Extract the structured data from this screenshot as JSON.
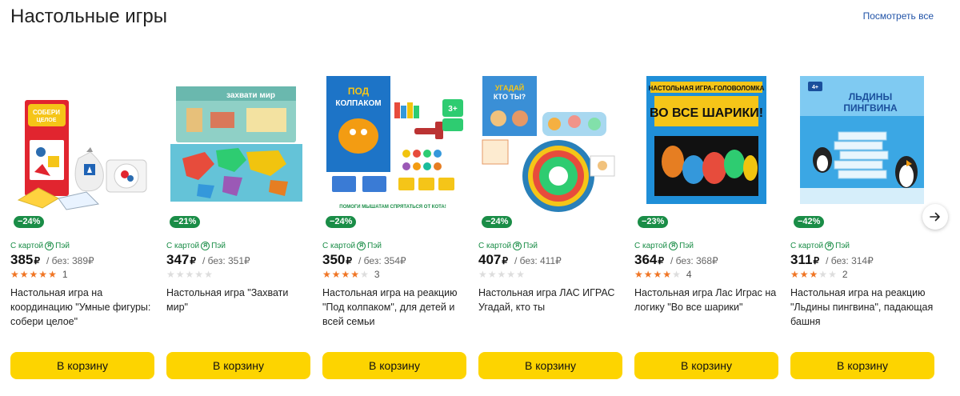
{
  "header": {
    "title": "Настольные игры",
    "see_all": "Посмотреть все"
  },
  "colors": {
    "accent_button": "#fdd400",
    "discount_badge": "#1a8d47",
    "star_on": "#f07524",
    "star_off": "#dddddd",
    "link": "#2254a8"
  },
  "products": [
    {
      "discount": "−24%",
      "pay_label_a": "С картой",
      "pay_label_b": "Пэй",
      "price": "385",
      "currency": "₽",
      "old_price": "/ без: 389₽",
      "rating": 5,
      "reviews": "1",
      "name": "Настольная игра на координацию \"Умные фигуры: собери целое\"",
      "button": "В корзину",
      "image_text": "СОБЕРИ ЦЕЛОЕ"
    },
    {
      "discount": "−21%",
      "pay_label_a": "С картой",
      "pay_label_b": "Пэй",
      "price": "347",
      "currency": "₽",
      "old_price": "/ без: 351₽",
      "rating": 0,
      "reviews": "",
      "name": "Настольная игра \"Захвати мир\"",
      "button": "В корзину",
      "image_text": "ЗАХВАТИ МИР"
    },
    {
      "discount": "−24%",
      "pay_label_a": "С картой",
      "pay_label_b": "Пэй",
      "price": "350",
      "currency": "₽",
      "old_price": "/ без: 354₽",
      "rating": 3.5,
      "reviews": "3",
      "name": "Настольная игра на реакцию \"Под колпаком\", для детей и всей семьи",
      "button": "В корзину",
      "image_text": "ПОМОГИ МЫШАТАМ СПРЯТАТЬСЯ ОТ КОТА!"
    },
    {
      "discount": "−24%",
      "pay_label_a": "С картой",
      "pay_label_b": "Пэй",
      "price": "407",
      "currency": "₽",
      "old_price": "/ без: 411₽",
      "rating": 0,
      "reviews": "",
      "name": "Настольная игра ЛАС ИГРАС Угадай, кто ты",
      "button": "В корзину",
      "image_text": "УГАДАЙ КТО ТЫ?"
    },
    {
      "discount": "−23%",
      "pay_label_a": "С картой",
      "pay_label_b": "Пэй",
      "price": "364",
      "currency": "₽",
      "old_price": "/ без: 368₽",
      "rating": 4,
      "reviews": "4",
      "name": "Настольная игра Лас Играс на логику \"Во все шарики\"",
      "button": "В корзину",
      "image_text": "ВО ВСЕ ШАРИКИ!"
    },
    {
      "discount": "−42%",
      "pay_label_a": "С картой",
      "pay_label_b": "Пэй",
      "price": "311",
      "currency": "₽",
      "old_price": "/ без: 314₽",
      "rating": 3,
      "reviews": "2",
      "name": "Настольная игра на реакцию \"Льдины пингвина\", падающая башня",
      "button": "В корзину",
      "image_text": "ЛЬДИНЫ ПИНГВИНА"
    }
  ],
  "pager": {
    "icon": "arrow-right-icon"
  }
}
